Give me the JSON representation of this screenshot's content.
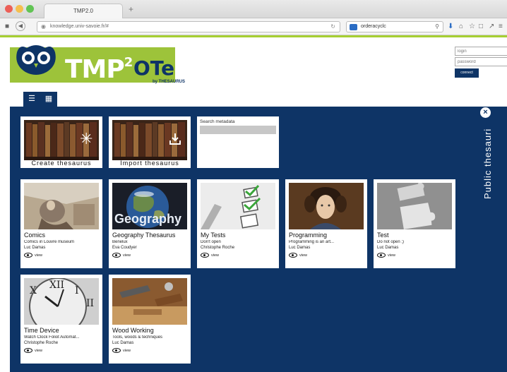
{
  "browser": {
    "tab_title": "TMP2.0",
    "new_tab_icon": "+",
    "url": "knowledge.univ-savoie.fr/#",
    "search_value": "orderacyclc"
  },
  "header": {
    "logo_main": "TMP",
    "logo_sup": "2",
    "logo_ote": "OTe",
    "logo_ote_sub": "by THESAURUS",
    "login_placeholder": "login",
    "password_placeholder": "password",
    "connect_label": "connect"
  },
  "view_toggle": {
    "list_icon": "list-icon",
    "grid_icon": "grid-icon"
  },
  "side_tab": {
    "label": "Public thesauri",
    "close_icon": "×"
  },
  "actions": {
    "create_label": "Create thesaurus",
    "import_label": "Import thesaurus",
    "search_label": "Search metadata"
  },
  "thesauri": [
    {
      "title": "Comics",
      "description": "Comics in Louvre museum",
      "author": "Luc Damas",
      "view_label": "view"
    },
    {
      "title": "Geography Thesaurus",
      "description": "Benelux",
      "author": "Eva Coudyer",
      "view_label": "view",
      "image_text": "Geography"
    },
    {
      "title": "My Tests",
      "description": "Don't open",
      "author": "Christophe Roche",
      "view_label": "view"
    },
    {
      "title": "Programming",
      "description": "Programming is an art...",
      "author": "Luc Damas",
      "view_label": "view"
    },
    {
      "title": "Test",
      "description": "Do not open ;)",
      "author": "Luc Damas",
      "view_label": "view"
    },
    {
      "title": "Time Device",
      "description": "Watch Clock Foliot Automat...",
      "author": "Christophe Roche",
      "view_label": "view"
    },
    {
      "title": "Wood Working",
      "description": "Tools, woods & techniques",
      "author": "Luc Damas",
      "view_label": "view"
    }
  ],
  "colors": {
    "navy": "#0e3466",
    "logo_green": "#9dc33a"
  }
}
